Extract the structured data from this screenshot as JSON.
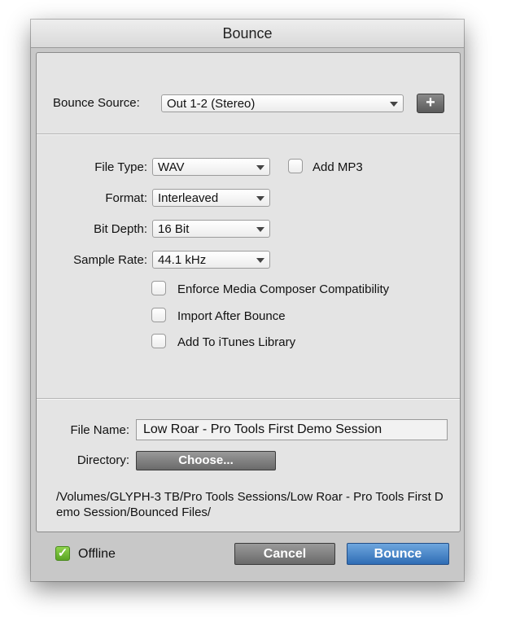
{
  "window": {
    "title": "Bounce"
  },
  "source": {
    "label": "Bounce Source:",
    "value": "Out 1-2 (Stereo)",
    "add_button": "+"
  },
  "options": {
    "file_type": {
      "label": "File Type:",
      "value": "WAV"
    },
    "add_mp3": {
      "label": "Add MP3",
      "checked": false
    },
    "format": {
      "label": "Format:",
      "value": "Interleaved"
    },
    "bit_depth": {
      "label": "Bit Depth:",
      "value": "16 Bit"
    },
    "sample_rate": {
      "label": "Sample Rate:",
      "value": "44.1 kHz"
    },
    "enforce": {
      "label": "Enforce Media Composer Compatibility",
      "checked": false
    },
    "import_after": {
      "label": "Import After Bounce",
      "checked": false
    },
    "itunes": {
      "label": "Add To iTunes Library",
      "checked": false
    }
  },
  "file": {
    "name_label": "File Name:",
    "name_value": "Low Roar - Pro Tools First Demo Session",
    "directory_label": "Directory:",
    "choose_label": "Choose...",
    "path": "/Volumes/GLYPH-3 TB/Pro Tools Sessions/Low Roar - Pro Tools First Demo Session/Bounced Files/"
  },
  "footer": {
    "offline_label": "Offline",
    "offline_checked": true,
    "offline_check_glyph": "✓",
    "cancel_label": "Cancel",
    "bounce_label": "Bounce"
  },
  "colors": {
    "accent": "#3a7bc8",
    "check_green": "#6cbb2f"
  }
}
